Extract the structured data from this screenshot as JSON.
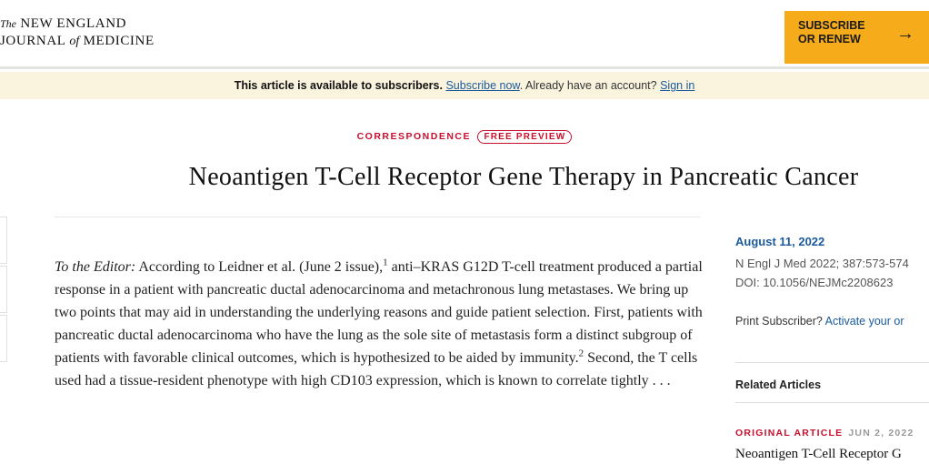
{
  "header": {
    "logo": {
      "the": "The",
      "new_england": "NEW ENGLAND",
      "journal": "JOURNAL",
      "of": "of",
      "medicine": "MEDICINE"
    },
    "subscribe_button": {
      "line1": "SUBSCRIBE",
      "line2": "OR RENEW",
      "arrow": "→"
    }
  },
  "banner": {
    "lead": "This article is available to subscribers.",
    "subscribe_link": "Subscribe now",
    "period": ".",
    "account_text": "Already have an account?",
    "sign_in_link": "Sign in"
  },
  "article": {
    "kicker": "CORRESPONDENCE",
    "badge": "FREE PREVIEW",
    "title": "Neoantigen T-Cell Receptor Gene Therapy in Pancreatic Cancer",
    "body": {
      "lead": "To the Editor:",
      "p1": " According to Leidner et al. (June 2 issue),",
      "ref1": "1",
      "p2": " anti–KRAS G12D T-cell treatment produced a partial response in a patient with pancreatic ductal adenocarcinoma and metachronous lung metastases. We bring up two points that may aid in understanding the underlying reasons and guide patient selection. First, patients with pancreatic ductal adenocarcinoma who have the lung as the sole site of metastasis form a distinct subgroup of patients with favorable clinical outcomes, which is hypothesized to be aided by immunity.",
      "ref2": "2",
      "p3": " Second, the T cells used had a tissue-resident phenotype with high CD103 expression, which is known to correlate tightly . . ."
    }
  },
  "sidebar": {
    "date": "August 11, 2022",
    "citation": "N Engl J Med 2022; 387:573-574",
    "doi": "DOI: 10.1056/NEJMc2208623",
    "print_text": "Print Subscriber?",
    "activate_link": "Activate your or",
    "related_heading": "Related Articles",
    "related_type": "ORIGINAL ARTICLE",
    "related_date": "JUN 2, 2022",
    "related_title": "Neoantigen T-Cell Receptor G"
  },
  "colors": {
    "accent_red": "#c8102e",
    "link_blue": "#1a5a9c",
    "subscribe_orange": "#f5ab1a",
    "banner_bg": "#faf3de"
  }
}
